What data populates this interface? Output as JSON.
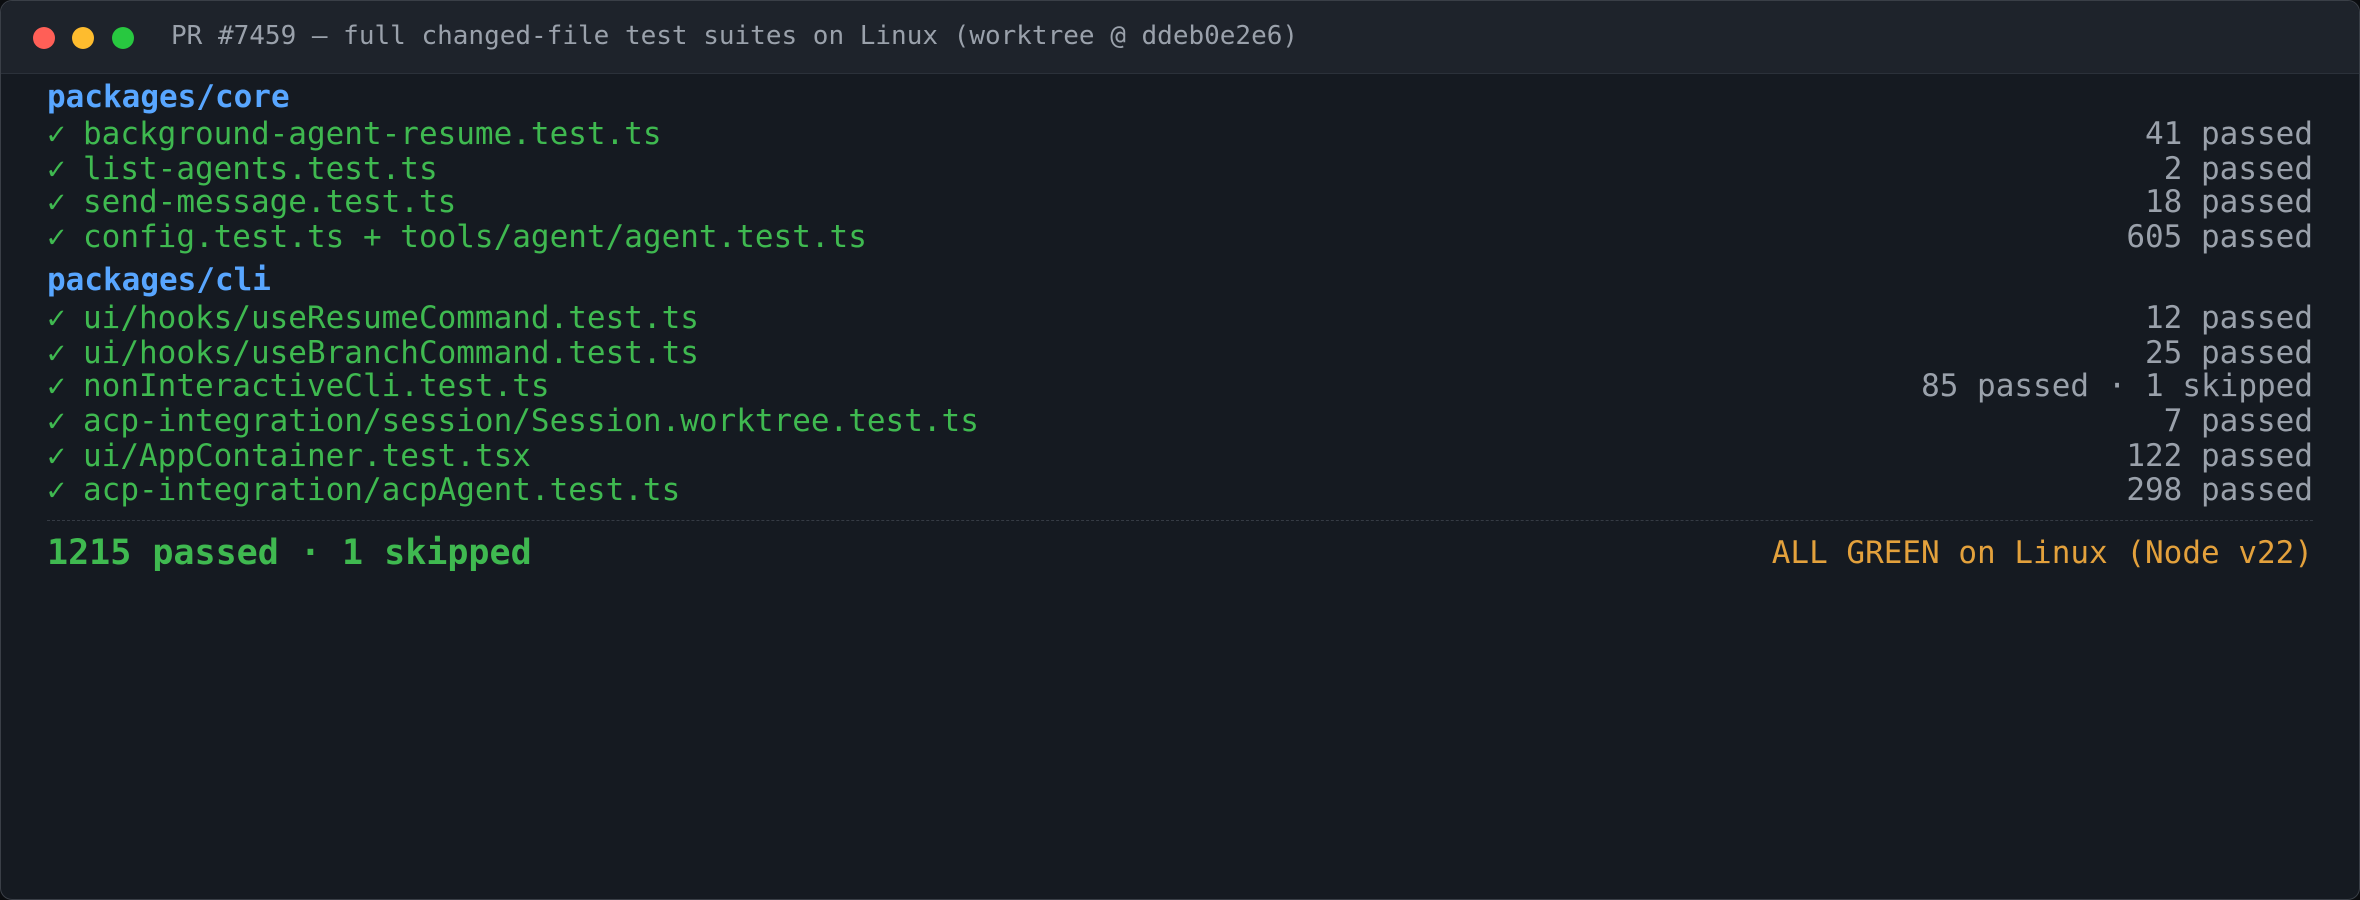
{
  "window": {
    "title": "PR #7459 — full changed-file test suites on Linux (worktree @ ddeb0e2e6)"
  },
  "colors": {
    "background": "#151a21",
    "titlebar": "#1e232b",
    "pass_green": "#3fb950",
    "heading_blue": "#58a6ff",
    "muted_gray": "#9aa1ab",
    "status_orange": "#e3a13c"
  },
  "sections": [
    {
      "heading": "packages/core",
      "rows": [
        {
          "mark": "✓",
          "file": "background-agent-resume.test.ts",
          "result": "41 passed"
        },
        {
          "mark": "✓",
          "file": "list-agents.test.ts",
          "result": "2 passed"
        },
        {
          "mark": "✓",
          "file": "send-message.test.ts",
          "result": "18 passed"
        },
        {
          "mark": "✓",
          "file": "config.test.ts + tools/agent/agent.test.ts",
          "result": "605 passed"
        }
      ]
    },
    {
      "heading": "packages/cli",
      "rows": [
        {
          "mark": "✓",
          "file": "ui/hooks/useResumeCommand.test.ts",
          "result": "12 passed"
        },
        {
          "mark": "✓",
          "file": "ui/hooks/useBranchCommand.test.ts",
          "result": "25 passed"
        },
        {
          "mark": "✓",
          "file": "nonInteractiveCli.test.ts",
          "result": "85 passed · 1 skipped"
        },
        {
          "mark": "✓",
          "file": "acp-integration/session/Session.worktree.test.ts",
          "result": "7 passed"
        },
        {
          "mark": "✓",
          "file": "ui/AppContainer.test.tsx",
          "result": "122 passed"
        },
        {
          "mark": "✓",
          "file": "acp-integration/acpAgent.test.ts",
          "result": "298 passed"
        }
      ]
    }
  ],
  "summary": {
    "totals": "1215 passed · 1 skipped",
    "status": "ALL GREEN on Linux (Node v22)"
  }
}
